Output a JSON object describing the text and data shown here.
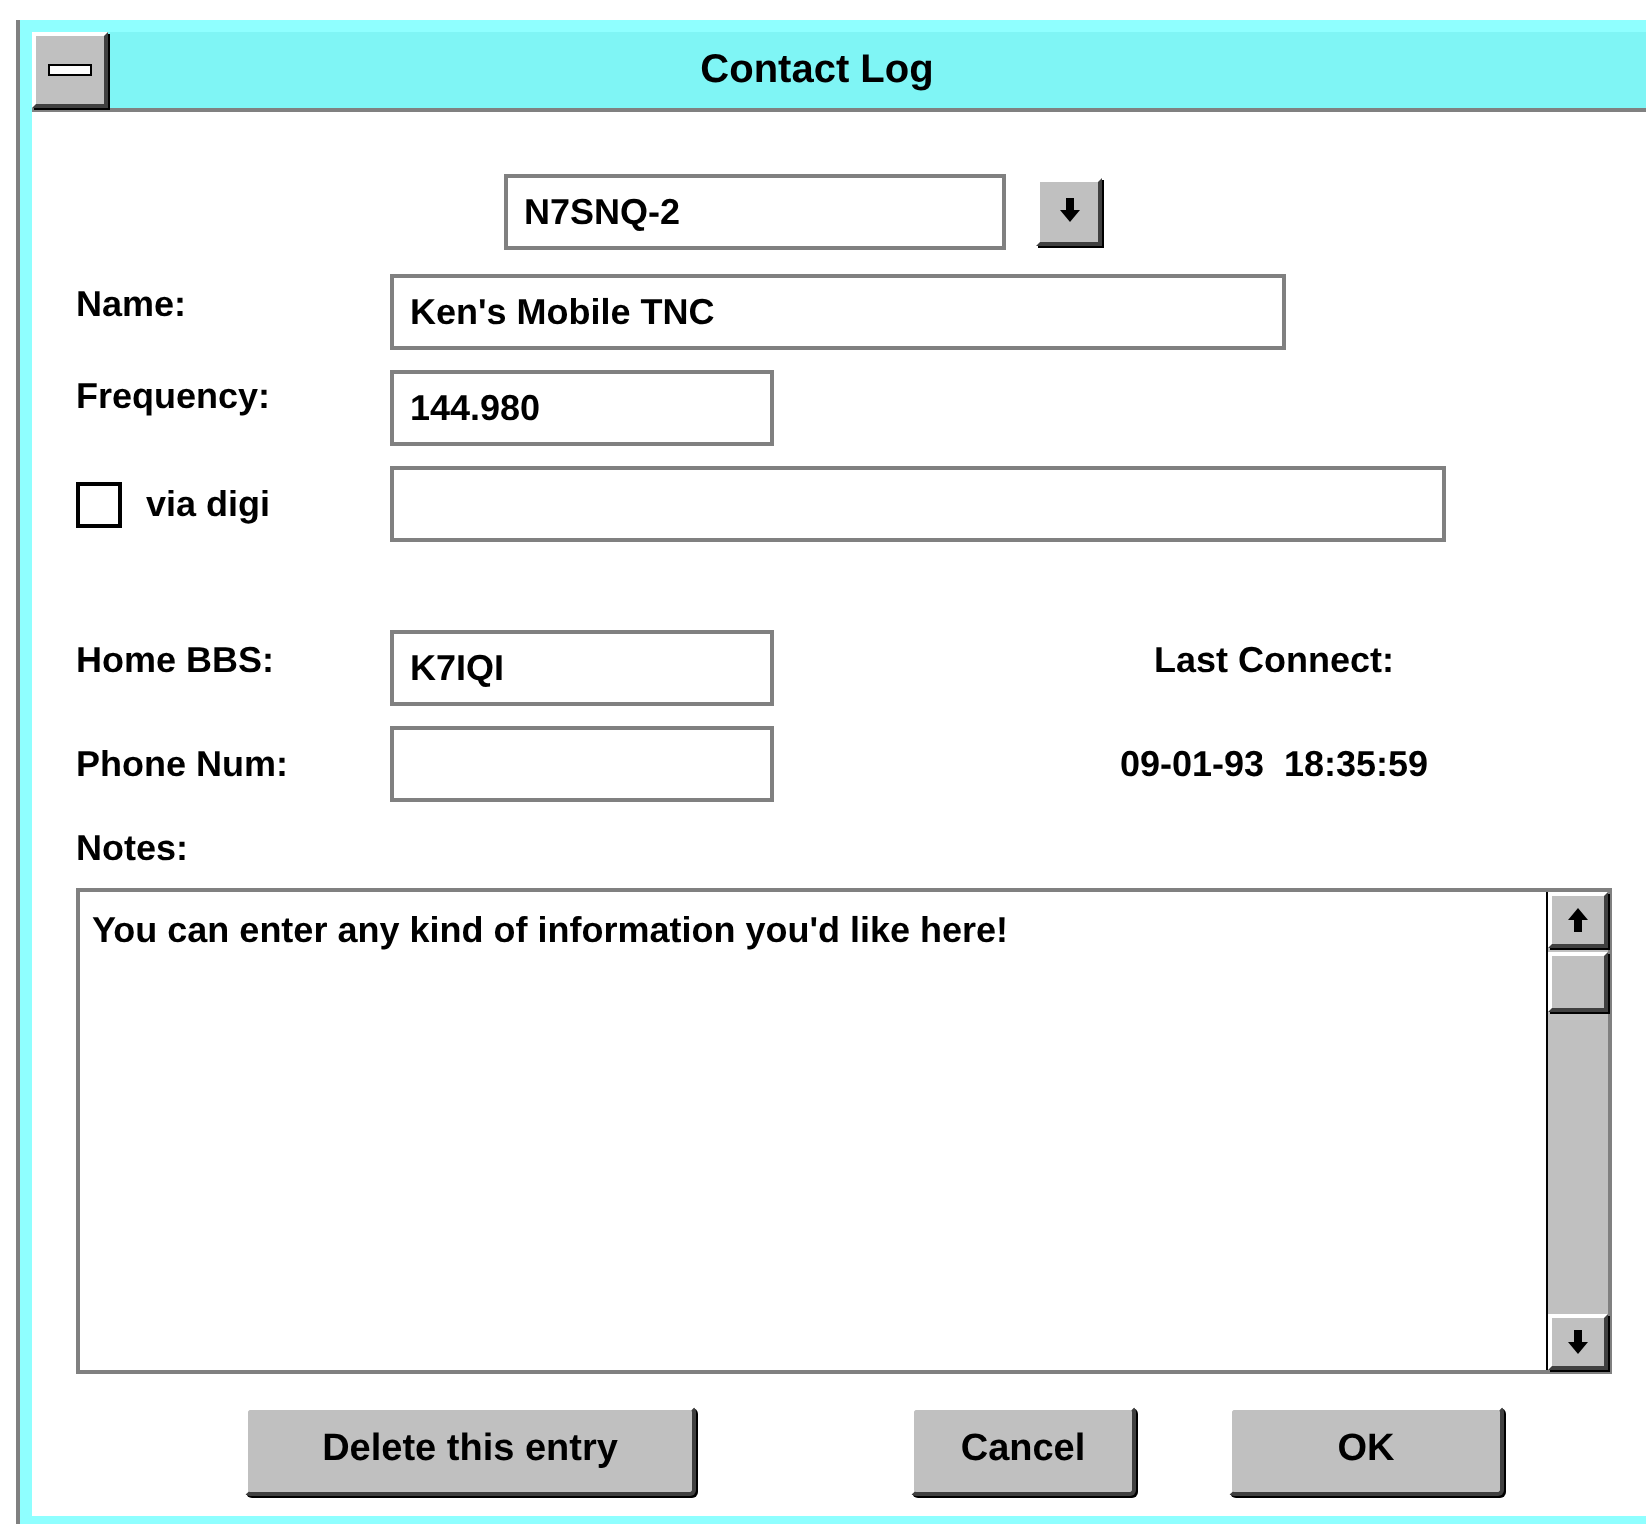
{
  "window": {
    "title": "Contact Log"
  },
  "station": {
    "value": "N7SNQ-2"
  },
  "name": {
    "label": "Name:",
    "value": "Ken's Mobile TNC"
  },
  "frequency": {
    "label": "Frequency:",
    "value": "144.980"
  },
  "via_digi": {
    "label": "via digi",
    "checked": false
  },
  "home_bbs": {
    "label": "Home BBS:",
    "value": "K7IQI"
  },
  "phone_num": {
    "label": "Phone Num:"
  },
  "last_connect": {
    "label": "Last Connect:",
    "value": "09-01-93  18:35:59"
  },
  "notes": {
    "label": "Notes:",
    "value": "You can enter any kind of information you'd like here!"
  },
  "buttons": [
    {
      "label": "Delete this entry",
      "kind": "delete"
    },
    {
      "label": "Cancel",
      "kind": "cancel"
    },
    {
      "label": "OK",
      "kind": "ok"
    }
  ]
}
